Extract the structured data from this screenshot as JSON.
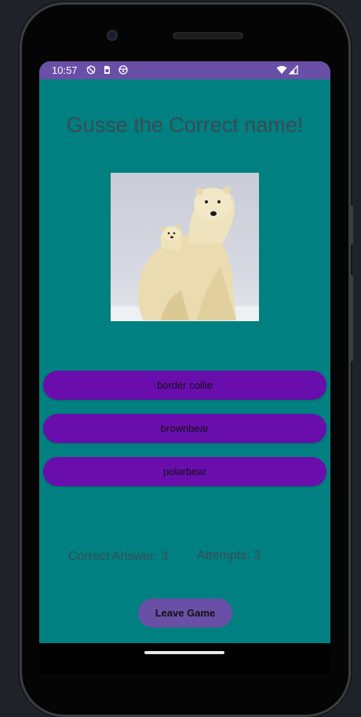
{
  "status_bar": {
    "time": "10:57",
    "left_icons": [
      "shield-icon",
      "sim-card-icon",
      "notification-face-icon"
    ],
    "right_icons": [
      "wifi-icon",
      "signal-icon"
    ]
  },
  "game": {
    "title": "Gusse the Correct name!",
    "image": "polar-bear-with-cub",
    "options": [
      "border collie",
      "brownbear",
      "polarbear"
    ],
    "correct_answer_text": "Correct Answer: 3",
    "attempts_text": "Attempts: 3",
    "leave_label": "Leave Game"
  },
  "colors": {
    "background": "#008080",
    "status_bar": "#6a4fa6",
    "option_button": "#6a0dad",
    "leave_button": "#6a4fa6",
    "title_text": "#3b4a55"
  }
}
